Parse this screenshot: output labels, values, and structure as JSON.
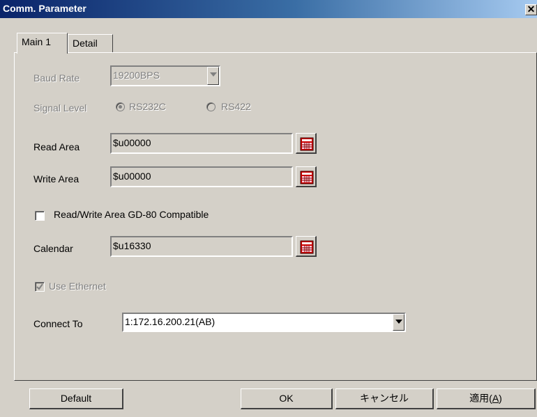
{
  "window": {
    "title": "Comm. Parameter",
    "close_glyph": "✕"
  },
  "tabs": [
    {
      "label": "Main 1",
      "active": true
    },
    {
      "label": "Detail",
      "active": false
    }
  ],
  "baud_rate": {
    "label": "Baud Rate",
    "value": "19200BPS",
    "enabled": false
  },
  "signal_level": {
    "label": "Signal Level",
    "options": [
      {
        "label": "RS232C",
        "selected": true
      },
      {
        "label": "RS422",
        "selected": false
      }
    ],
    "enabled": false
  },
  "read_area": {
    "label": "Read Area",
    "value": "$u00000"
  },
  "write_area": {
    "label": "Write Area",
    "value": "$u00000"
  },
  "gd80_compatible": {
    "label": "Read/Write Area GD-80 Compatible",
    "checked": false
  },
  "calendar": {
    "label": "Calendar",
    "value": "$u16330"
  },
  "use_ethernet": {
    "label": "Use Ethernet",
    "checked": true,
    "enabled": false
  },
  "connect_to": {
    "label": "Connect To",
    "value": "1:172.16.200.21(AB)"
  },
  "buttons": {
    "default": "Default",
    "ok": "OK",
    "cancel": "キャンセル",
    "apply_prefix": "適用(",
    "apply_key": "A",
    "apply_suffix": ")"
  },
  "icons": {
    "calendar": "calendar-icon",
    "close": "close-icon",
    "dropdown": "chevron-down-icon",
    "check": "check-icon"
  },
  "colors": {
    "titlebar_start": "#0a246a",
    "titlebar_end": "#a6caf0",
    "dialog_face": "#d4d0c8",
    "calendar_icon_red": "#cc0000"
  }
}
